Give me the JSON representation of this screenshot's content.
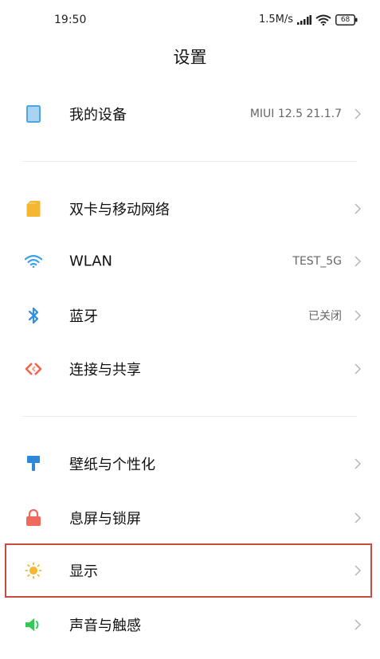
{
  "status_bar": {
    "time": "19:50",
    "speed": "1.5M/s",
    "battery": "68"
  },
  "header": {
    "title": "设置"
  },
  "rows": [
    {
      "label": "我的设备",
      "value": "MIUI 12.5 21.1.7",
      "icon": "device-icon"
    },
    {
      "label": "双卡与移动网络",
      "value": "",
      "icon": "sim-card-icon"
    },
    {
      "label": "WLAN",
      "value": "TEST_5G",
      "icon": "wifi-icon"
    },
    {
      "label": "蓝牙",
      "value": "已关闭",
      "icon": "bluetooth-icon"
    },
    {
      "label": "连接与共享",
      "value": "",
      "icon": "connection-share-icon"
    },
    {
      "label": "壁纸与个性化",
      "value": "",
      "icon": "brush-icon"
    },
    {
      "label": "息屏与锁屏",
      "value": "",
      "icon": "lock-icon"
    },
    {
      "label": "显示",
      "value": "",
      "icon": "sun-icon"
    },
    {
      "label": "声音与触感",
      "value": "",
      "icon": "speaker-icon"
    }
  ],
  "colors": {
    "device": "#4aa6e6",
    "sim": "#f5b731",
    "wifi": "#3aa0e8",
    "bluetooth": "#2f8fe0",
    "share": "#f0654e",
    "brush": "#2e88d8",
    "lock": "#f06a5c",
    "sun": "#f5b731",
    "speaker": "#34c759",
    "highlight": "#c94a3f"
  }
}
